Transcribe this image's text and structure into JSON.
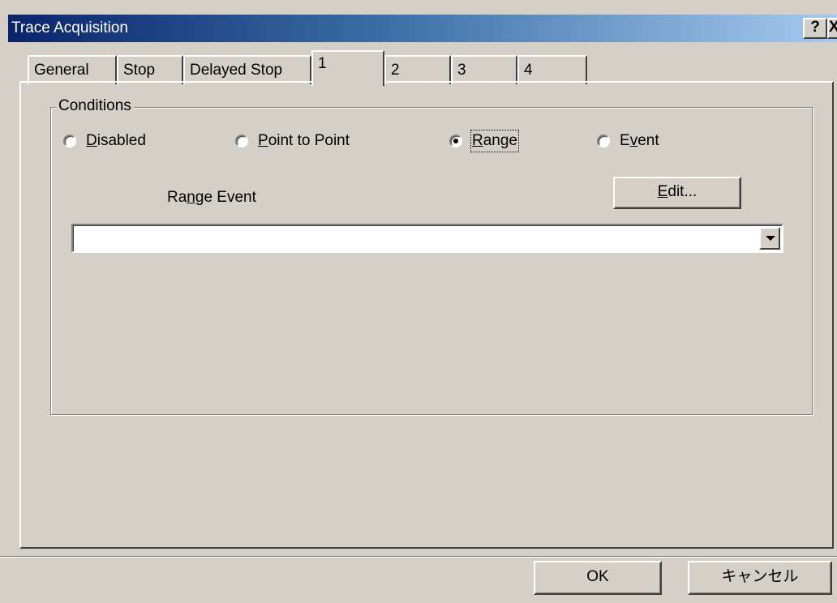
{
  "window": {
    "title": "Trace Acquisition",
    "help_label": "?",
    "close_label": "X"
  },
  "tabs": [
    {
      "label": "General",
      "active": false
    },
    {
      "label": "Stop",
      "active": false
    },
    {
      "label": "Delayed Stop",
      "active": false
    },
    {
      "label": "1",
      "active": true
    },
    {
      "label": "2",
      "active": false
    },
    {
      "label": "3",
      "active": false
    },
    {
      "label": "4",
      "active": false
    }
  ],
  "conditions": {
    "group_label": "Conditions",
    "options": [
      {
        "label": "Disabled",
        "accel": "D",
        "rest": "isabled",
        "checked": false
      },
      {
        "label": "Point to Point",
        "accel": "P",
        "rest": "oint to Point",
        "checked": false
      },
      {
        "label": "Range",
        "accel": "R",
        "rest": "ange",
        "checked": true
      },
      {
        "label": "Event",
        "pre": "E",
        "accel": "v",
        "rest": "ent",
        "checked": false
      }
    ],
    "range_event_label": {
      "pre": "Ra",
      "accel": "n",
      "rest": "ge Event"
    },
    "edit_button": {
      "accel": "E",
      "rest": "dit..."
    },
    "range_event_value": ""
  },
  "footer": {
    "ok_label": "OK",
    "cancel_label": "キャンセル"
  }
}
